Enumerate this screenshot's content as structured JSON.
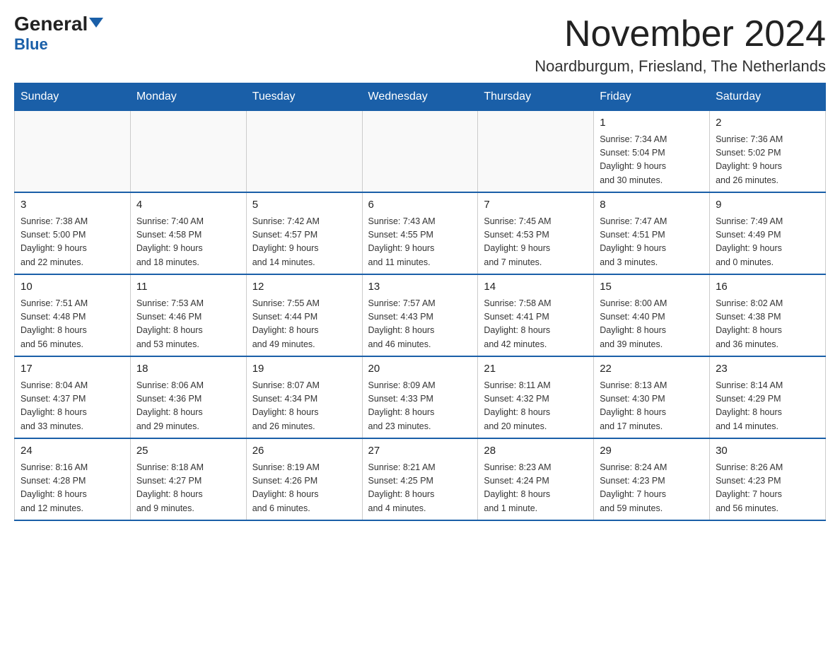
{
  "logo": {
    "line1a": "General",
    "line1b": "Blue"
  },
  "title": {
    "month": "November 2024",
    "location": "Noardburgum, Friesland, The Netherlands"
  },
  "days_of_week": [
    "Sunday",
    "Monday",
    "Tuesday",
    "Wednesday",
    "Thursday",
    "Friday",
    "Saturday"
  ],
  "weeks": [
    [
      {
        "day": "",
        "info": ""
      },
      {
        "day": "",
        "info": ""
      },
      {
        "day": "",
        "info": ""
      },
      {
        "day": "",
        "info": ""
      },
      {
        "day": "",
        "info": ""
      },
      {
        "day": "1",
        "info": "Sunrise: 7:34 AM\nSunset: 5:04 PM\nDaylight: 9 hours\nand 30 minutes."
      },
      {
        "day": "2",
        "info": "Sunrise: 7:36 AM\nSunset: 5:02 PM\nDaylight: 9 hours\nand 26 minutes."
      }
    ],
    [
      {
        "day": "3",
        "info": "Sunrise: 7:38 AM\nSunset: 5:00 PM\nDaylight: 9 hours\nand 22 minutes."
      },
      {
        "day": "4",
        "info": "Sunrise: 7:40 AM\nSunset: 4:58 PM\nDaylight: 9 hours\nand 18 minutes."
      },
      {
        "day": "5",
        "info": "Sunrise: 7:42 AM\nSunset: 4:57 PM\nDaylight: 9 hours\nand 14 minutes."
      },
      {
        "day": "6",
        "info": "Sunrise: 7:43 AM\nSunset: 4:55 PM\nDaylight: 9 hours\nand 11 minutes."
      },
      {
        "day": "7",
        "info": "Sunrise: 7:45 AM\nSunset: 4:53 PM\nDaylight: 9 hours\nand 7 minutes."
      },
      {
        "day": "8",
        "info": "Sunrise: 7:47 AM\nSunset: 4:51 PM\nDaylight: 9 hours\nand 3 minutes."
      },
      {
        "day": "9",
        "info": "Sunrise: 7:49 AM\nSunset: 4:49 PM\nDaylight: 9 hours\nand 0 minutes."
      }
    ],
    [
      {
        "day": "10",
        "info": "Sunrise: 7:51 AM\nSunset: 4:48 PM\nDaylight: 8 hours\nand 56 minutes."
      },
      {
        "day": "11",
        "info": "Sunrise: 7:53 AM\nSunset: 4:46 PM\nDaylight: 8 hours\nand 53 minutes."
      },
      {
        "day": "12",
        "info": "Sunrise: 7:55 AM\nSunset: 4:44 PM\nDaylight: 8 hours\nand 49 minutes."
      },
      {
        "day": "13",
        "info": "Sunrise: 7:57 AM\nSunset: 4:43 PM\nDaylight: 8 hours\nand 46 minutes."
      },
      {
        "day": "14",
        "info": "Sunrise: 7:58 AM\nSunset: 4:41 PM\nDaylight: 8 hours\nand 42 minutes."
      },
      {
        "day": "15",
        "info": "Sunrise: 8:00 AM\nSunset: 4:40 PM\nDaylight: 8 hours\nand 39 minutes."
      },
      {
        "day": "16",
        "info": "Sunrise: 8:02 AM\nSunset: 4:38 PM\nDaylight: 8 hours\nand 36 minutes."
      }
    ],
    [
      {
        "day": "17",
        "info": "Sunrise: 8:04 AM\nSunset: 4:37 PM\nDaylight: 8 hours\nand 33 minutes."
      },
      {
        "day": "18",
        "info": "Sunrise: 8:06 AM\nSunset: 4:36 PM\nDaylight: 8 hours\nand 29 minutes."
      },
      {
        "day": "19",
        "info": "Sunrise: 8:07 AM\nSunset: 4:34 PM\nDaylight: 8 hours\nand 26 minutes."
      },
      {
        "day": "20",
        "info": "Sunrise: 8:09 AM\nSunset: 4:33 PM\nDaylight: 8 hours\nand 23 minutes."
      },
      {
        "day": "21",
        "info": "Sunrise: 8:11 AM\nSunset: 4:32 PM\nDaylight: 8 hours\nand 20 minutes."
      },
      {
        "day": "22",
        "info": "Sunrise: 8:13 AM\nSunset: 4:30 PM\nDaylight: 8 hours\nand 17 minutes."
      },
      {
        "day": "23",
        "info": "Sunrise: 8:14 AM\nSunset: 4:29 PM\nDaylight: 8 hours\nand 14 minutes."
      }
    ],
    [
      {
        "day": "24",
        "info": "Sunrise: 8:16 AM\nSunset: 4:28 PM\nDaylight: 8 hours\nand 12 minutes."
      },
      {
        "day": "25",
        "info": "Sunrise: 8:18 AM\nSunset: 4:27 PM\nDaylight: 8 hours\nand 9 minutes."
      },
      {
        "day": "26",
        "info": "Sunrise: 8:19 AM\nSunset: 4:26 PM\nDaylight: 8 hours\nand 6 minutes."
      },
      {
        "day": "27",
        "info": "Sunrise: 8:21 AM\nSunset: 4:25 PM\nDaylight: 8 hours\nand 4 minutes."
      },
      {
        "day": "28",
        "info": "Sunrise: 8:23 AM\nSunset: 4:24 PM\nDaylight: 8 hours\nand 1 minute."
      },
      {
        "day": "29",
        "info": "Sunrise: 8:24 AM\nSunset: 4:23 PM\nDaylight: 7 hours\nand 59 minutes."
      },
      {
        "day": "30",
        "info": "Sunrise: 8:26 AM\nSunset: 4:23 PM\nDaylight: 7 hours\nand 56 minutes."
      }
    ]
  ]
}
